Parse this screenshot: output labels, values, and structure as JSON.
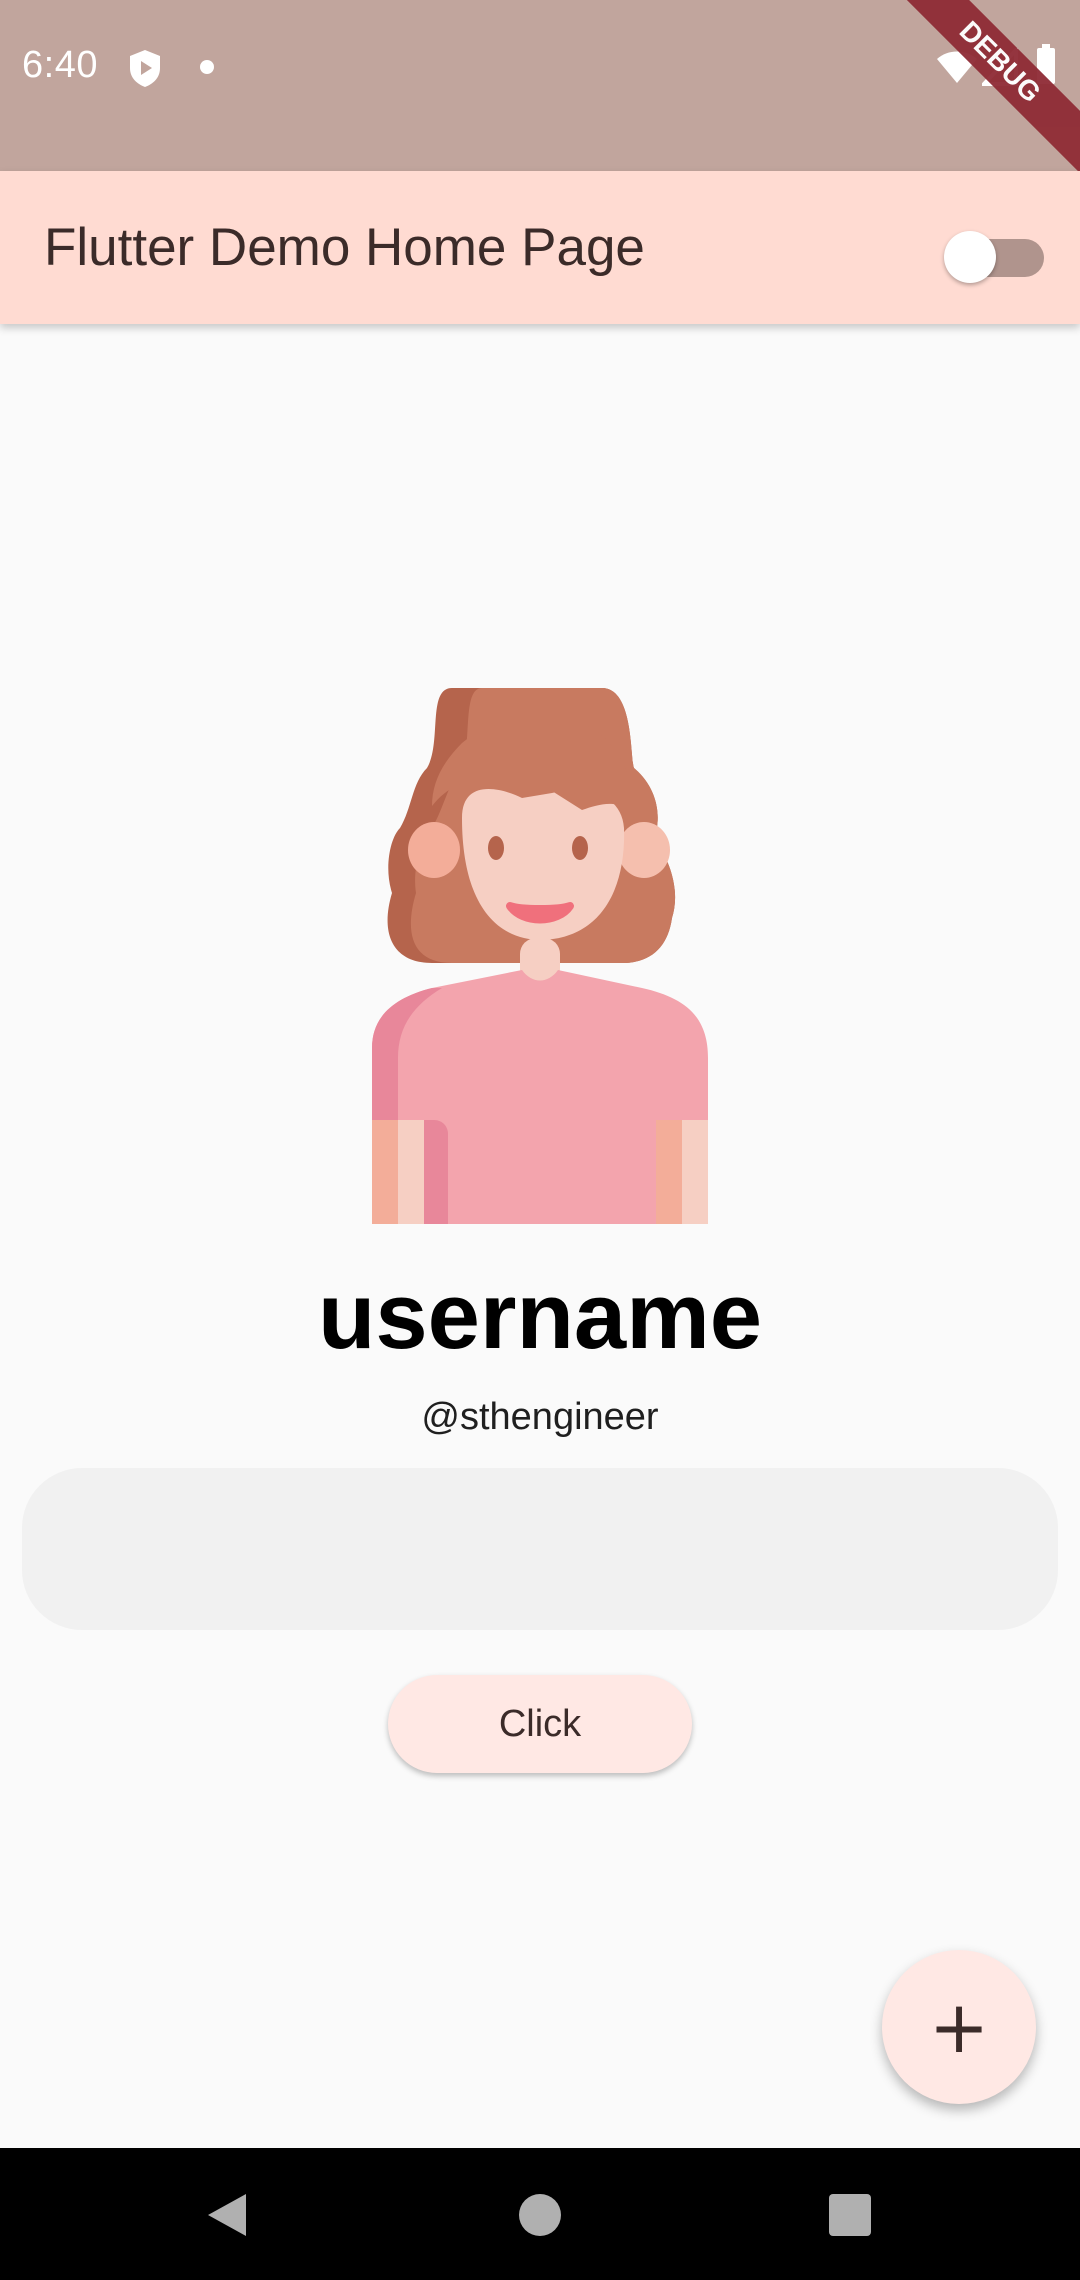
{
  "status_bar": {
    "time": "6:40",
    "icons": [
      "shield-icon",
      "dot-icon",
      "wifi-icon",
      "signal-icon",
      "battery-icon"
    ],
    "debug_label": "DEBUG"
  },
  "app_bar": {
    "title": "Flutter Demo Home Page",
    "toggle_on": false
  },
  "profile": {
    "avatar_icon": "woman-avatar-icon",
    "username": "username",
    "handle": "@sthengineer"
  },
  "input": {
    "value": "",
    "placeholder": ""
  },
  "buttons": {
    "click_label": "Click",
    "fab_label": "+"
  },
  "nav_bar": {
    "icons": [
      "back-icon",
      "home-icon",
      "recents-icon"
    ]
  },
  "colors": {
    "status_bar": "#c1a59d",
    "app_bar": "#ffdbd2",
    "button_bg": "#ffe8e4",
    "background": "#fafafa"
  }
}
